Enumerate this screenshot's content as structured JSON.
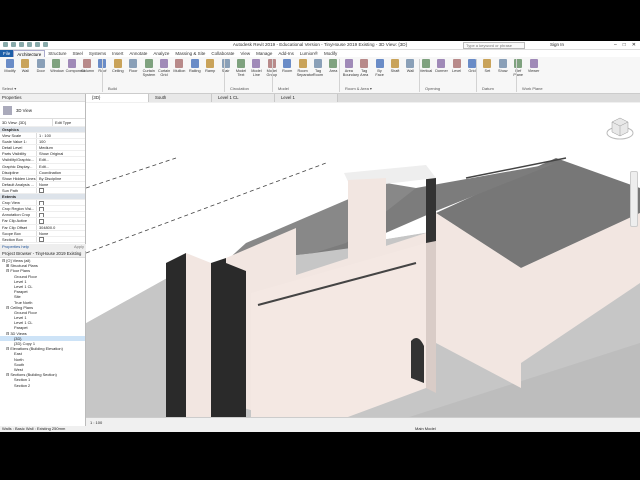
{
  "app": {
    "title": "Autodesk Revit 2019 - Educational Version - TinyHouse 2019 Existing - 3D View: {3D}",
    "search_placeholder": "Type a keyword or phrase",
    "sign_in": "Sign In"
  },
  "ribbon_tabs": [
    "File",
    "Architecture",
    "Structure",
    "Steel",
    "Systems",
    "Insert",
    "Annotate",
    "Analyze",
    "Massing & Site",
    "Collaborate",
    "View",
    "Manage",
    "Add-Ins",
    "Lumion®",
    "Modify"
  ],
  "ribbon_buttons": [
    "Modify",
    "Wall",
    "Door",
    "Window",
    "Component",
    "Column",
    "Roof",
    "Ceiling",
    "Floor",
    "Curtain System",
    "Curtain Grid",
    "Mullion",
    "Railing",
    "Ramp",
    "Stair",
    "Model Text",
    "Model Line",
    "Model Group",
    "Room",
    "Room Separator",
    "Tag Room",
    "Area",
    "Area Boundary",
    "Tag Area",
    "By Face",
    "Shaft",
    "Wall",
    "Vertical",
    "Dormer",
    "Level",
    "Grid",
    "Set",
    "Show",
    "Ref Plane",
    "Viewer"
  ],
  "ribbon_panels": [
    "Select ▾",
    "Build",
    "Circulation",
    "Model",
    "Room & Area ▾",
    "Opening",
    "Datum",
    "Work Plane"
  ],
  "doc_tabs": [
    "{3D}",
    "South",
    "Level 1 CL",
    "Level 1"
  ],
  "properties": {
    "title": "Properties",
    "type_name": "3D View",
    "instance": "3D View: {3D}",
    "edit_type": "Edit Type",
    "rows": [
      {
        "k": "Graphics",
        "v": "",
        "section": true
      },
      {
        "k": "View Scale",
        "v": "1 : 100"
      },
      {
        "k": "Scale Value 1:",
        "v": "100"
      },
      {
        "k": "Detail Level",
        "v": "Medium"
      },
      {
        "k": "Parts Visibility",
        "v": "Show Original"
      },
      {
        "k": "Visibility/Graphic...",
        "v": "Edit..."
      },
      {
        "k": "Graphic Display...",
        "v": "Edit..."
      },
      {
        "k": "Discipline",
        "v": "Coordination"
      },
      {
        "k": "Show Hidden Lines",
        "v": "By Discipline"
      },
      {
        "k": "Default Analysis ...",
        "v": "None"
      },
      {
        "k": "Sun Path",
        "v": "",
        "cb": true
      },
      {
        "k": "Extents",
        "v": "",
        "section": true
      },
      {
        "k": "Crop View",
        "v": "",
        "cb": true
      },
      {
        "k": "Crop Region Visi...",
        "v": "",
        "cb": true
      },
      {
        "k": "Annotation Crop",
        "v": "",
        "cb": true
      },
      {
        "k": "Far Clip Active",
        "v": "",
        "cb": true
      },
      {
        "k": "Far Clip Offset",
        "v": "304800.0"
      },
      {
        "k": "Scope Box",
        "v": "None"
      },
      {
        "k": "Section Box",
        "v": "",
        "cb": true
      }
    ],
    "help": "Properties help",
    "apply": "Apply"
  },
  "browser": {
    "title": "Project Browser - TinyHouse 2019 Existing",
    "items": [
      {
        "label": "⊟ [O] Views (all)",
        "indent": 0
      },
      {
        "label": "⊞ Structural Plans",
        "indent": 1
      },
      {
        "label": "⊟ Floor Plans",
        "indent": 1
      },
      {
        "label": "Ground Floor",
        "indent": 3
      },
      {
        "label": "Level 1",
        "indent": 3
      },
      {
        "label": "Level 1 CL",
        "indent": 3
      },
      {
        "label": "Parapet",
        "indent": 3
      },
      {
        "label": "Site",
        "indent": 3
      },
      {
        "label": "True North",
        "indent": 3
      },
      {
        "label": "⊟ Ceiling Plans",
        "indent": 1
      },
      {
        "label": "Ground Floor",
        "indent": 3
      },
      {
        "label": "Level 1",
        "indent": 3
      },
      {
        "label": "Level 1 CL",
        "indent": 3
      },
      {
        "label": "Parapet",
        "indent": 3
      },
      {
        "label": "⊟ 3D Views",
        "indent": 1
      },
      {
        "label": "{3D}",
        "indent": 3,
        "sel": true
      },
      {
        "label": "{3D} Copy 1",
        "indent": 3
      },
      {
        "label": "⊟ Elevations (Building Elevation)",
        "indent": 1
      },
      {
        "label": "East",
        "indent": 3
      },
      {
        "label": "North",
        "indent": 3
      },
      {
        "label": "South",
        "indent": 3
      },
      {
        "label": "West",
        "indent": 3
      },
      {
        "label": "⊟ Sections (Building Section)",
        "indent": 1
      },
      {
        "label": "Section 1",
        "indent": 3
      },
      {
        "label": "Section 2",
        "indent": 3
      }
    ]
  },
  "view_status": {
    "scale": "1 : 100"
  },
  "status": {
    "left": "Walls : Basic Wall : Existing 250mm",
    "right": "Main Model"
  },
  "colors": {
    "file_tab": "#1e5fa8",
    "wall_light": "#f2e6e1",
    "wall_dark": "#2a2a2a",
    "roof": "#7a7a7a",
    "ground": "#c8c8c8"
  }
}
